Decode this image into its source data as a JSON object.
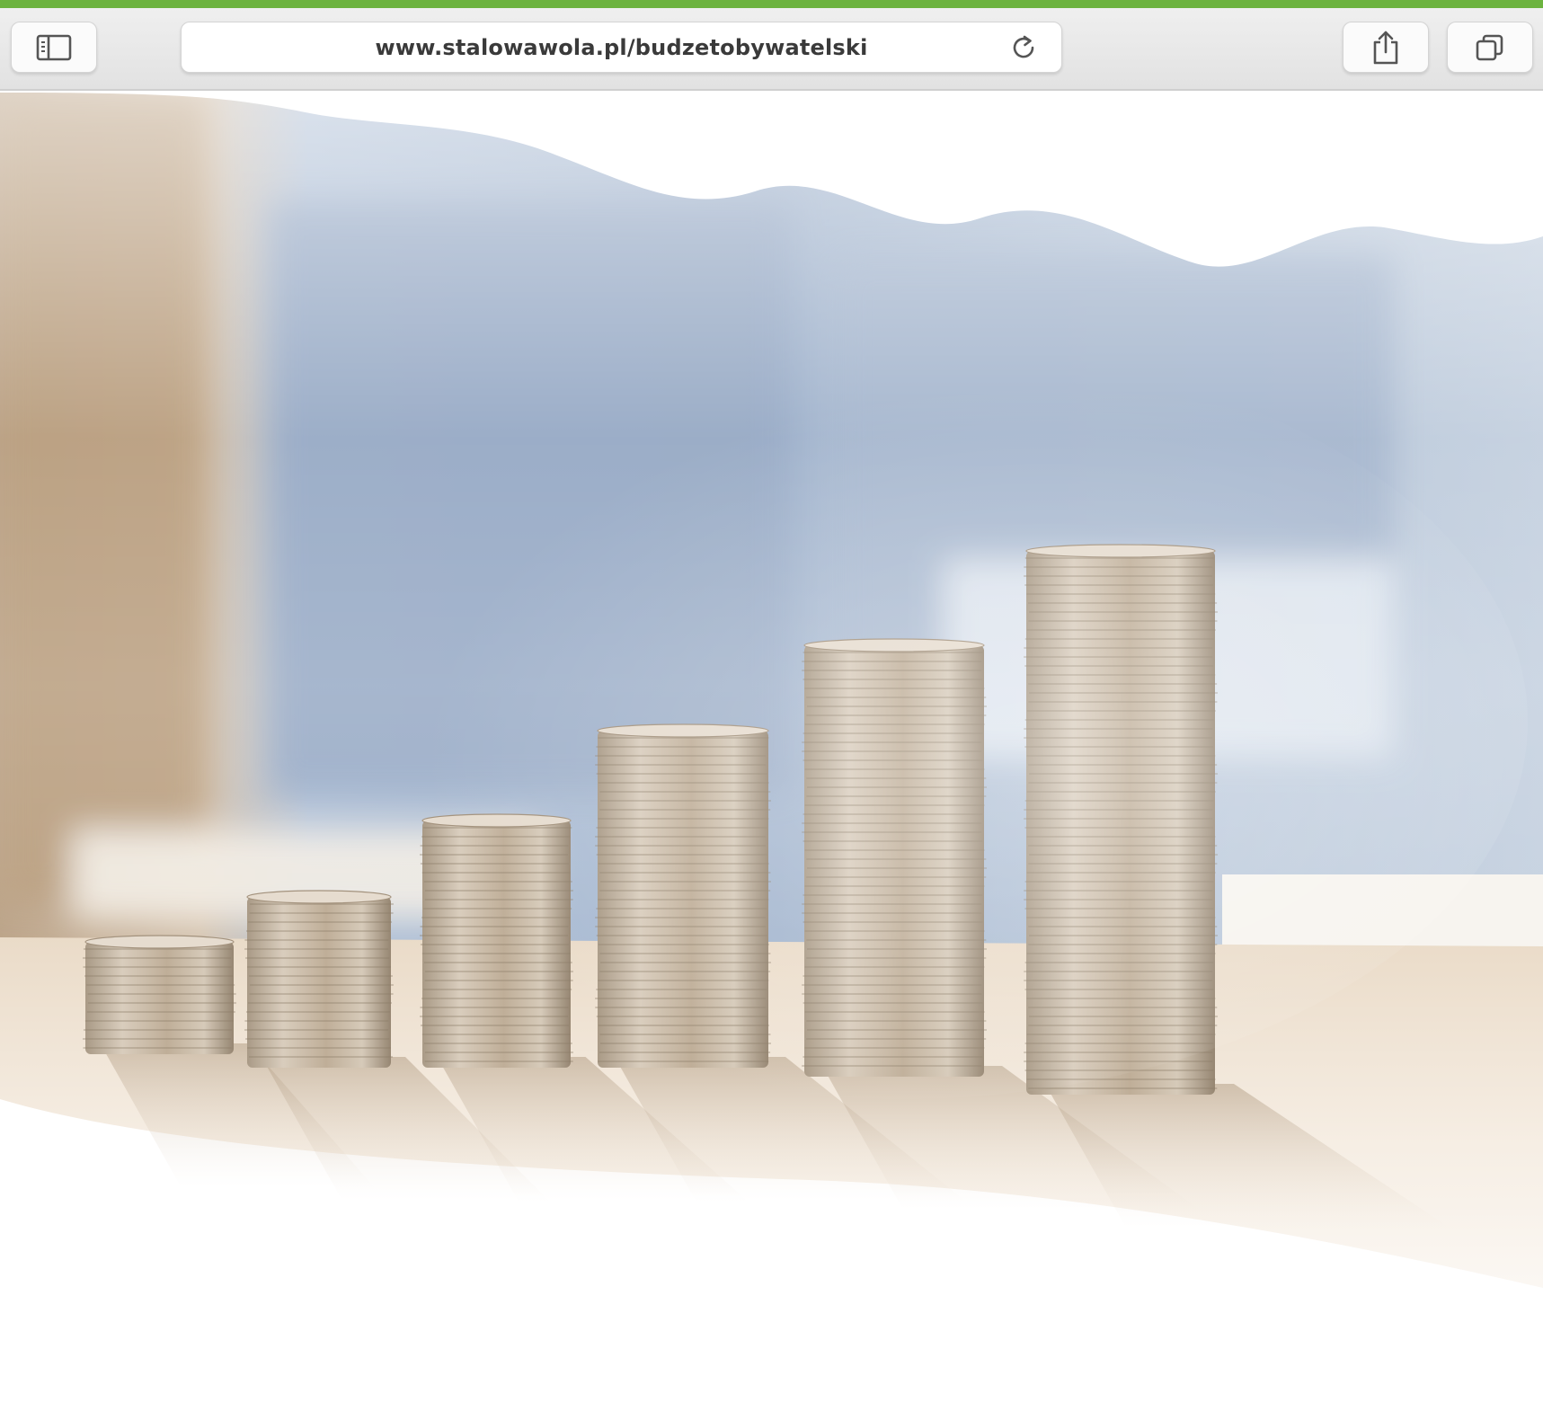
{
  "colors": {
    "accent": "#6cb33f",
    "toolbar_icon": "#555555",
    "url_text": "#3a3a3a"
  },
  "browser": {
    "url": "www.stalowawola.pl/budzetobywatelski",
    "icons": {
      "sidebar": "sidebar-icon",
      "reload": "reload-icon",
      "share": "share-icon",
      "tabs": "tabs-icon"
    }
  },
  "content": {
    "image_subject": "coin-stacks-photo"
  }
}
